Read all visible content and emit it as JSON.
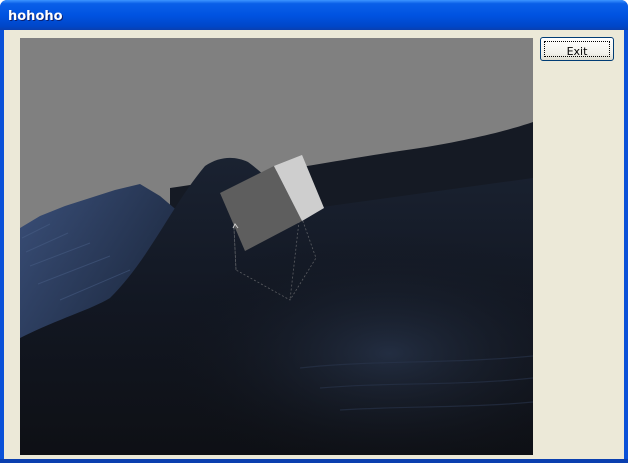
{
  "window": {
    "title": "hohoho"
  },
  "buttons": {
    "exit_label": "Exit"
  },
  "viewport": {
    "scene": "3d-terrain-with-cube",
    "sky_color": "#808080",
    "ground_color": "#11141a"
  },
  "colors": {
    "titlebar": "#0053e1",
    "client_background": "#ece9d8"
  }
}
